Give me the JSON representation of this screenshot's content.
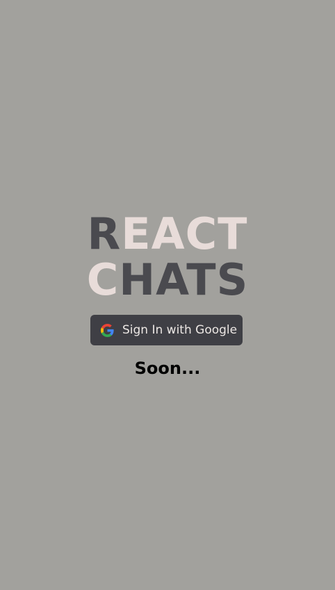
{
  "logo": {
    "line1": [
      {
        "text": "R",
        "tone": "dark"
      },
      {
        "text": "EACT",
        "tone": "light"
      }
    ],
    "line2": [
      {
        "text": "C",
        "tone": "light"
      },
      {
        "text": "HATS",
        "tone": "dark"
      }
    ]
  },
  "signin_button": {
    "label": "Sign In with Google",
    "icon": "google-icon"
  },
  "status": {
    "text": "Soon..."
  },
  "colors": {
    "background": "#a2a19d",
    "logo_dark": "#4a4a4f",
    "logo_light": "#e8dcd9",
    "button_bg": "#3f3f45",
    "button_text": "#ece7e4"
  }
}
